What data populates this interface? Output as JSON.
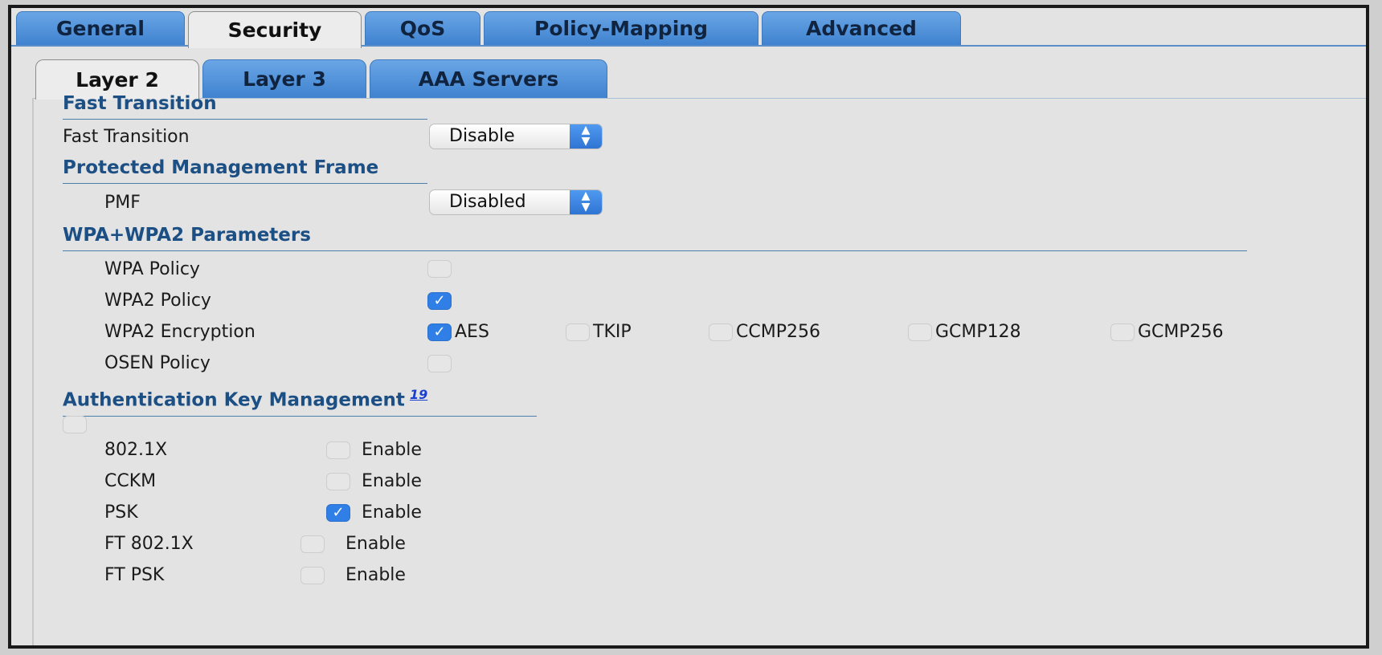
{
  "tabs_top": [
    {
      "label": "General",
      "active": false
    },
    {
      "label": "Security",
      "active": true
    },
    {
      "label": "QoS",
      "active": false
    },
    {
      "label": "Policy-Mapping",
      "active": false
    },
    {
      "label": "Advanced",
      "active": false
    }
  ],
  "tabs_sub": [
    {
      "label": "Layer 2",
      "active": true
    },
    {
      "label": "Layer 3",
      "active": false
    },
    {
      "label": "AAA Servers",
      "active": false
    }
  ],
  "fast_transition": {
    "header": "Fast Transition",
    "label": "Fast Transition",
    "value": "Disable"
  },
  "pmf": {
    "header": "Protected Management Frame",
    "label": "PMF",
    "value": "Disabled"
  },
  "wpa": {
    "header": "WPA+WPA2 Parameters",
    "wpa_policy": {
      "label": "WPA Policy",
      "checked": false
    },
    "wpa2_policy": {
      "label": "WPA2 Policy",
      "checked": true
    },
    "wpa2_encryption": {
      "label": "WPA2 Encryption",
      "options": [
        {
          "label": "AES",
          "checked": true
        },
        {
          "label": "TKIP",
          "checked": false
        },
        {
          "label": "CCMP256",
          "checked": false
        },
        {
          "label": "GCMP128",
          "checked": false
        },
        {
          "label": "GCMP256",
          "checked": false
        }
      ]
    },
    "osen_policy": {
      "label": "OSEN Policy",
      "checked": false
    }
  },
  "akm": {
    "header": "Authentication Key Management",
    "footnote": "19",
    "select_all_checked": false,
    "items": [
      {
        "label": "802.1X",
        "enable_label": "Enable",
        "checked": false
      },
      {
        "label": "CCKM",
        "enable_label": "Enable",
        "checked": false
      },
      {
        "label": "PSK",
        "enable_label": "Enable",
        "checked": true
      },
      {
        "label": "FT 802.1X",
        "enable_label": "Enable",
        "checked": false
      },
      {
        "label": "FT PSK",
        "enable_label": "Enable",
        "checked": false
      }
    ]
  },
  "colors": {
    "tab_blue": "#4a8fdc",
    "header_text": "#1c4f84",
    "checkbox_on": "#2f7fe6",
    "background": "#e3e3e3"
  }
}
